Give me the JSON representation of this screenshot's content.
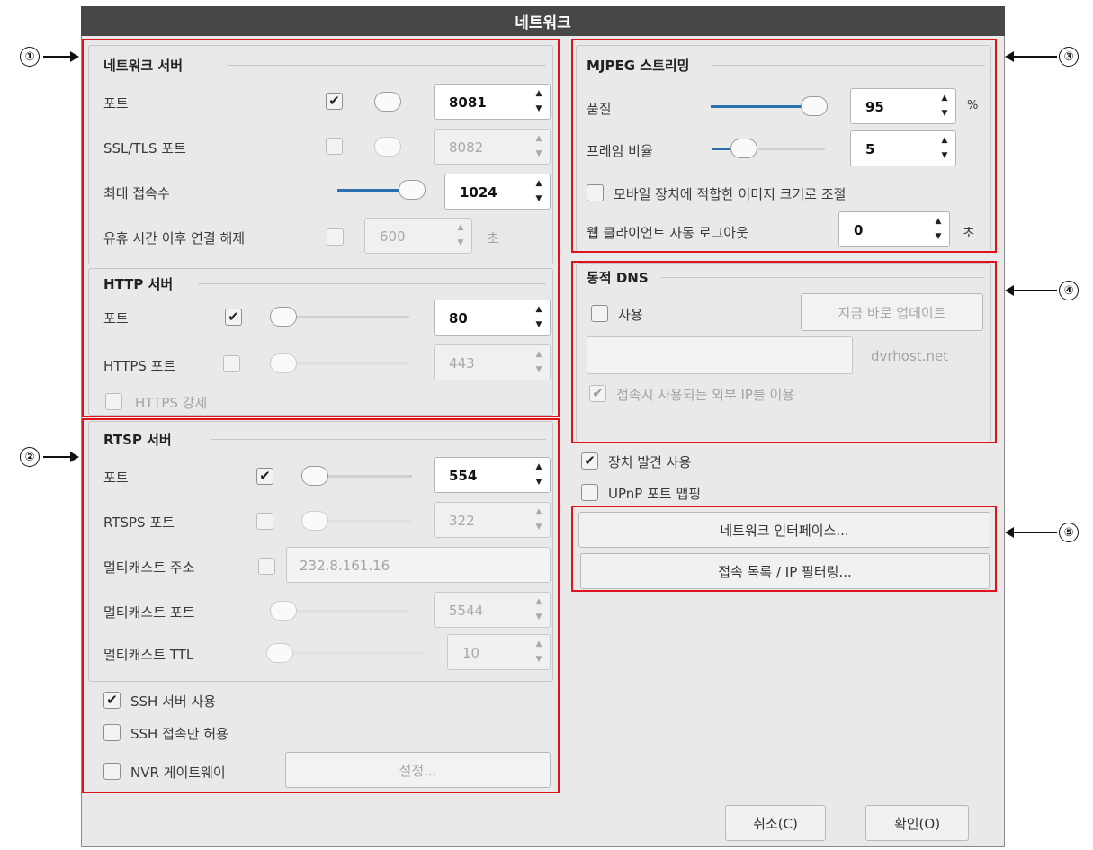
{
  "window": {
    "title": "네트워크"
  },
  "network_server": {
    "title": "네트워크 서버",
    "port_label": "포트",
    "port_value": "8081",
    "ssl_label": "SSL/TLS 포트",
    "ssl_value": "8082",
    "maxconn_label": "최대 접속수",
    "maxconn_value": "1024",
    "idle_label": "유휴 시간 이후 연결 해제",
    "idle_value": "600",
    "idle_unit": "초"
  },
  "http_server": {
    "title": "HTTP 서버",
    "port_label": "포트",
    "port_value": "80",
    "https_label": "HTTPS 포트",
    "https_value": "443",
    "force_label": "HTTPS 강제"
  },
  "rtsp_server": {
    "title": "RTSP 서버",
    "port_label": "포트",
    "port_value": "554",
    "rtsps_label": "RTSPS 포트",
    "rtsps_value": "322",
    "mc_addr_label": "멀티캐스트 주소",
    "mc_addr_value": "232.8.161.16",
    "mc_port_label": "멀티캐스트 포트",
    "mc_port_value": "5544",
    "mc_ttl_label": "멀티캐스트 TTL",
    "mc_ttl_value": "10"
  },
  "ssh": {
    "enable_label": "SSH 서버 사용",
    "only_label": "SSH 접속만 허용"
  },
  "nvr": {
    "label": "NVR 게이트웨이",
    "setup_button": "설정..."
  },
  "mjpeg": {
    "title": "MJPEG 스트리밍",
    "quality_label": "품질",
    "quality_value": "95",
    "quality_unit": "%",
    "fps_label": "프레임 비율",
    "fps_value": "5",
    "mobile_label": "모바일 장치에 적합한 이미지 크기로 조절",
    "logout_label": "웹 클라이언트 자동 로그아웃",
    "logout_value": "0",
    "logout_unit": "초"
  },
  "ddns": {
    "title": "동적 DNS",
    "use_label": "사용",
    "update_button": "지금 바로 업데이트",
    "domain_suffix": "dvrhost.net",
    "external_ip_label": "접속시 사용되는 외부 IP를 이용"
  },
  "discovery": {
    "label": "장치 발견 사용"
  },
  "upnp": {
    "label": "UPnP 포트 맵핑"
  },
  "buttons": {
    "interfaces": "네트워크 인터페이스...",
    "access_list": "접속 목록 / IP 필터링...",
    "cancel": "취소(C)",
    "ok": "확인(O)"
  },
  "callouts": {
    "c1": "①",
    "c2": "②",
    "c3": "③",
    "c4": "④",
    "c5": "⑤"
  },
  "state": {
    "port_checked": true,
    "ssl_checked": false,
    "idle_checked": false,
    "http_port_checked": true,
    "https_checked": false,
    "force_https": false,
    "rtsp_port_checked": true,
    "rtsps_checked": false,
    "mc_addr_checked": false,
    "ssh_enable": true,
    "ssh_only": false,
    "nvr_gateway": false,
    "mobile_resize": false,
    "ddns_use": false,
    "external_ip": true,
    "discovery": true,
    "upnp": false,
    "quality_slider": 0.95,
    "fps_slider": 0.2,
    "maxconn_slider": 1.0
  },
  "colors": {
    "accent": "#2c6fb0",
    "highlight": "#e0121b",
    "titlebar": "#474747"
  }
}
